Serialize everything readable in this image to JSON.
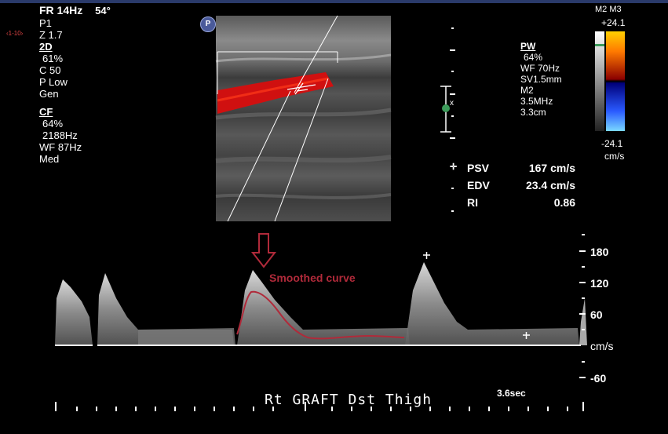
{
  "header": {
    "frame_rate": "FR 14Hz",
    "angle": "54°"
  },
  "tiny_label": "‹1-10›",
  "left_params": {
    "general": [
      "P1",
      "Z 1.7"
    ],
    "mode_2d": {
      "title": "2D",
      "lines": [
        "61%",
        "C 50",
        "P Low",
        "Gen"
      ]
    },
    "mode_cf": {
      "title": "CF",
      "lines": [
        "64%",
        "2188Hz",
        "WF  87Hz",
        "Med"
      ]
    }
  },
  "badge": "P",
  "right_params": {
    "title": "PW",
    "lines": [
      "64%",
      "WF  70Hz",
      "SV1.5mm",
      "M2",
      "3.5MHz",
      "3.3cm"
    ]
  },
  "gate_marker": "x",
  "measurements": [
    {
      "label": "PSV",
      "value": "167 cm/s"
    },
    {
      "label": "EDV",
      "value": "23.4 cm/s"
    },
    {
      "label": "RI",
      "value": "0.86"
    }
  ],
  "colorbar": {
    "title": "M2 M3",
    "max": "+24.1",
    "min": "-24.1",
    "unit": "cm/s"
  },
  "annotation": "Smoothed curve",
  "doppler_scale": [
    "180",
    "120",
    "60",
    "-60"
  ],
  "doppler_unit": "cm/s",
  "caption": "Rt  GRAFT Dst Thigh",
  "time_label": "3.6sec",
  "colors": {
    "annotation": "#b02a3a",
    "flow": "#d01010",
    "bar_top": "#2a3a6a"
  }
}
